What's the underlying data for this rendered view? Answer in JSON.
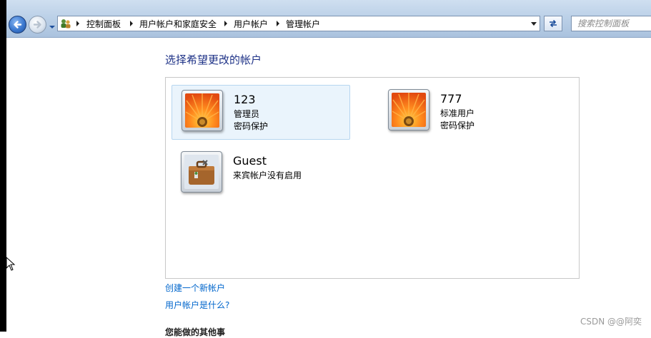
{
  "address_bar": {
    "breadcrumbs": [
      "控制面板",
      "用户帐户和家庭安全",
      "用户帐户",
      "管理帐户"
    ]
  },
  "search": {
    "placeholder": "搜索控制面板"
  },
  "main": {
    "heading": "选择希望更改的帐户",
    "accounts": [
      {
        "name": "123",
        "role": "管理员",
        "status": "密码保护",
        "icon": "orange-flower-avatar",
        "selected": true
      },
      {
        "name": "777",
        "role": "标准用户",
        "status": "密码保护",
        "icon": "orange-flower-avatar",
        "selected": false
      },
      {
        "name": "Guest",
        "role": "来宾帐户没有启用",
        "icon": "guest-suitcase-avatar",
        "selected": false
      }
    ],
    "links": {
      "create_account": "创建一个新帐户",
      "what_is_account": "用户帐户是什么?"
    },
    "next_section_partial": "您能做的其他事"
  },
  "watermark": "CSDN @@阿奕",
  "colors": {
    "heading": "#1e3287",
    "link": "#0066cc",
    "selected_bg": "#eaf4fc"
  }
}
